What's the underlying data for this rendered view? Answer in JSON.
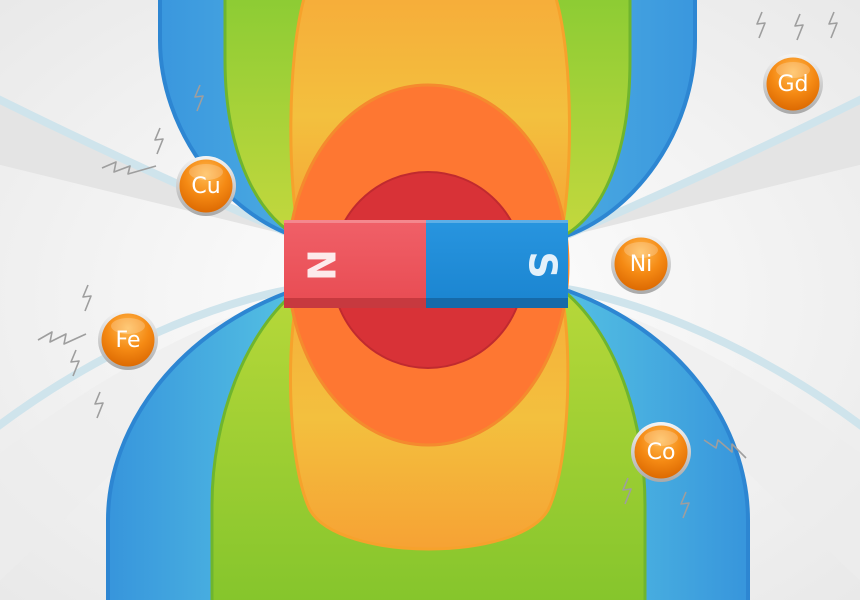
{
  "magnet": {
    "north_label": "N",
    "south_label": "S",
    "north_color": "#ee4d55",
    "south_color": "#1e8ad6"
  },
  "field_colors": {
    "core": "#d83237",
    "inner": "#fe7732",
    "middle": "#f7a937",
    "outer_green": "#8ccc2e",
    "outer_cyan": "#5ac9e4",
    "outer_blue": "#3795dc"
  },
  "elements": [
    {
      "id": "cu",
      "symbol": "Cu"
    },
    {
      "id": "fe",
      "symbol": "Fe"
    },
    {
      "id": "ni",
      "symbol": "Ni"
    },
    {
      "id": "co",
      "symbol": "Co"
    },
    {
      "id": "gd",
      "symbol": "Gd"
    }
  ]
}
